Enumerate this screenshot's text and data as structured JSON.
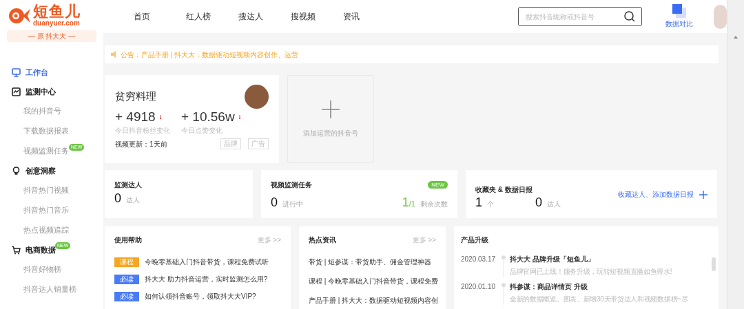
{
  "logo": {
    "name": "短鱼儿",
    "domain": "duanyuer.com",
    "tagline": "— 原 抖大大 —"
  },
  "sidebar": {
    "items": [
      {
        "label": "工作台",
        "selected": true
      },
      {
        "label": "监测中心",
        "selected": false,
        "children": [
          {
            "label": "我的抖音号"
          },
          {
            "label": "下载数据报表"
          },
          {
            "label": "视频监测任务",
            "badge": "NEW"
          }
        ]
      },
      {
        "label": "创意洞察",
        "selected": false,
        "children": [
          {
            "label": "抖音热门视频"
          },
          {
            "label": "抖音热门音乐"
          },
          {
            "label": "热点视频追踪"
          }
        ]
      },
      {
        "label": "电商数据",
        "selected": false,
        "badge": "NEW",
        "children": [
          {
            "label": "抖音好物榜"
          },
          {
            "label": "抖音达人销量榜"
          }
        ]
      }
    ]
  },
  "nav": {
    "items": [
      {
        "label": "首页"
      },
      {
        "label": "红人榜"
      },
      {
        "label": "搜达人"
      },
      {
        "label": "搜视频"
      },
      {
        "label": "资讯"
      }
    ],
    "search": {
      "placeholder": "搜索抖音昵称或抖音号"
    },
    "compare": {
      "label": "数据对比"
    }
  },
  "notice": {
    "text": "公告：产品手册 | 抖大大：数据驱动短视频内容创作、运营"
  },
  "account": {
    "name": "贫穷料理",
    "stats": [
      {
        "value": "+ 4918",
        "label": "今日抖音粉丝变化"
      },
      {
        "value": "+ 10.56w",
        "label": "今日点赞变化"
      }
    ],
    "update": "视频更新：1天前",
    "tags": [
      "品牌",
      "广告"
    ]
  },
  "add_card": {
    "label": "添加运营的抖音号"
  },
  "summary": [
    {
      "kind": "simple",
      "title": "监测达人",
      "figures": [
        {
          "value": "0",
          "unit": "达人",
          "highlight": false
        }
      ]
    },
    {
      "kind": "task",
      "title": "视频监测任务",
      "badge": "NEW",
      "figures": [
        {
          "value": "0",
          "unit": "进行中",
          "highlight": false
        },
        {
          "value": "1",
          "suffix": "/1",
          "unit": "剩余次数",
          "highlight": true
        }
      ]
    },
    {
      "kind": "favorites",
      "title": "收藏夹 & 数据日报",
      "link": "收藏达人、添加数据日报",
      "figures": [
        {
          "value": "1",
          "unit": "个",
          "highlight": false
        },
        {
          "value": "0",
          "unit": "达人",
          "highlight": false
        }
      ]
    }
  ],
  "help": {
    "title": "使用帮助",
    "more": "更多 >>",
    "items": [
      {
        "tag": "课程",
        "color": "#f5a623",
        "text": "今晚零基础入门抖音带货，课程免费试听"
      },
      {
        "tag": "必读",
        "color": "#4a7bf7",
        "text": "抖大大 助力抖音运营，实时监测怎么用?"
      },
      {
        "tag": "必读",
        "color": "#4a7bf7",
        "text": "如何认领抖音账号，领取抖大大VIP?"
      }
    ]
  },
  "news": {
    "title": "热点资讯",
    "more": "更多 >>",
    "items": [
      {
        "text": "带货 | 短参谋：带货助手、佣金管理神器"
      },
      {
        "text": "课程 | 今晚零基础入门抖音带货，课程免费"
      },
      {
        "text": "产品手册 | 抖大大：数据驱动短视频内容创"
      }
    ]
  },
  "upgrades": {
    "title": "产品升级",
    "items": [
      {
        "date": "2020.03.17",
        "title": "抖大大 品牌升级「短鱼儿」",
        "desc": "品牌官网已上线！服务升级，玩转短视频直播如鱼得水!"
      },
      {
        "date": "2020.01.10",
        "title": "抖参谋：商品详情页 升级",
        "desc": "全新的数据概览、图表、新增30天带货达人和视频数据榜~尽"
      }
    ]
  }
}
